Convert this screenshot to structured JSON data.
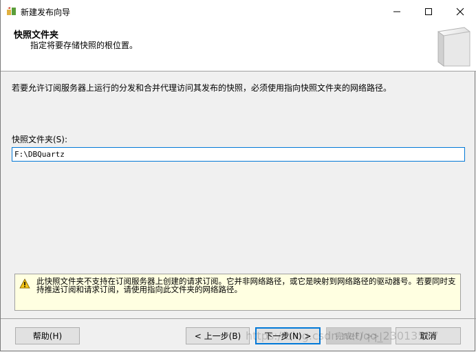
{
  "window": {
    "title": "新建发布向导"
  },
  "header": {
    "title": "快照文件夹",
    "subtitle": "指定将要存储快照的根位置。"
  },
  "main": {
    "description": "若要允许订阅服务器上运行的分发和合并代理访问其发布的快照，必须使用指向快照文件夹的网络路径。",
    "folder_label": "快照文件夹(S):",
    "folder_value": "F:\\DBQuartz",
    "warning": "此快照文件夹不支持在订阅服务器上创建的请求订阅。它并非网络路径，或它是映射到网络路径的驱动器号。若要同时支持推送订阅和请求订阅，请使用指向此文件夹的网络路径。"
  },
  "footer": {
    "help": "帮助(H)",
    "back": "< 上一步(B)",
    "next": "下一步(N) >",
    "finish": "完成(F) >>|",
    "cancel": "取消"
  },
  "watermark": "https://blog.csdn.net/qq_23013577",
  "colors": {
    "accent": "#0078d7",
    "warning_bg": "#ffffe1"
  },
  "icons": [
    "app-icon",
    "minimize-icon",
    "maximize-icon",
    "close-icon",
    "folder-graphic-icon",
    "warning-icon"
  ]
}
